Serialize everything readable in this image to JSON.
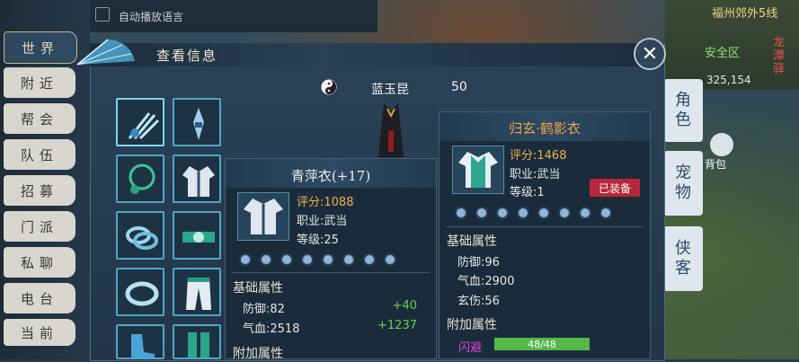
{
  "chat": {
    "tabs": [
      "世界",
      "附近",
      "帮会",
      "队伍",
      "招募",
      "门派",
      "私聊",
      "电台",
      "当前"
    ],
    "active_tab": 0,
    "auto_voice_label": "自动播放语言"
  },
  "hud": {
    "map_name": "福州郊外5线",
    "coords": "325,154",
    "safe_zone": "安全区",
    "area_tag": "龙潭驿",
    "side_buttons": [
      "角色",
      "宠物",
      "侠客"
    ],
    "bag_label": "背包"
  },
  "panel": {
    "title": "查看信息",
    "character_name": "蓝玉昆",
    "character_level": "50"
  },
  "hover_item": {
    "name": "青萍衣(+17)",
    "rating": "评分:1088",
    "school": "职业:武当",
    "level": "等级:25",
    "base_header": "基础属性",
    "stats": [
      {
        "label": "防御:82",
        "bonus": "+40"
      },
      {
        "label": "气血:2518",
        "bonus": "+1237"
      }
    ],
    "extra_header": "附加属性"
  },
  "equipped_item": {
    "name": "归玄·鹤影衣",
    "rating": "评分:1468",
    "school": "职业:武当",
    "level": "等级:1",
    "badge": "已装备",
    "base_header": "基础属性",
    "stats": [
      "防御:96",
      "气血:2900",
      "玄伤:56"
    ],
    "extra_header": "附加属性",
    "extra_stat": {
      "label": "闪避",
      "value": "48/48",
      "fill": 1.0
    }
  },
  "colors": {
    "accent_gold": "#f0b04a",
    "green_bonus": "#66d34a",
    "equipped_red": "#b8273a",
    "dodge_purple": "#e23fd9"
  }
}
